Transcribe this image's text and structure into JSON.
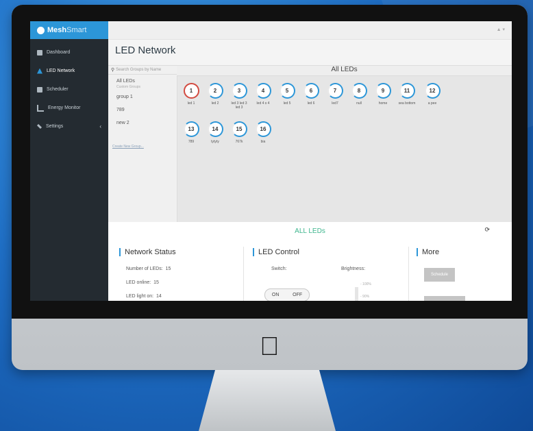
{
  "app": {
    "brand_bold": "Mesh",
    "brand_light": "Smart",
    "user_menu": "▲ ▾"
  },
  "sidebar": {
    "items": [
      {
        "label": "Dashboard",
        "icon": "dashboard-icon"
      },
      {
        "label": "LED Network",
        "icon": "network-icon"
      },
      {
        "label": "Scheduler",
        "icon": "calendar-icon"
      },
      {
        "label": "Energy Monitor",
        "icon": "bar-chart-icon"
      },
      {
        "label": "Settings",
        "icon": "wrench-icon",
        "chevron": "‹"
      }
    ]
  },
  "page": {
    "title": "LED Network"
  },
  "groups": {
    "search_placeholder": "Search Groups by Name",
    "all_leds": "All LEDs",
    "custom_heading": "Custom Groups",
    "items": [
      "group 1",
      "789",
      "new 2"
    ],
    "create_link": "Create New Group..."
  },
  "leds_header": "All LEDs",
  "leds": [
    {
      "num": "1",
      "label": "led 1"
    },
    {
      "num": "2",
      "label": "led 2"
    },
    {
      "num": "3",
      "label": "led 3 led 3 led 3"
    },
    {
      "num": "4",
      "label": "led 4 s 4"
    },
    {
      "num": "5",
      "label": "led 5"
    },
    {
      "num": "6",
      "label": "led 6"
    },
    {
      "num": "7",
      "label": "led7"
    },
    {
      "num": "8",
      "label": "null"
    },
    {
      "num": "9",
      "label": "home"
    },
    {
      "num": "11",
      "label": "sea bottom"
    },
    {
      "num": "12",
      "label": "a pee"
    },
    {
      "num": "13",
      "label": "789"
    },
    {
      "num": "14",
      "label": "tytyty"
    },
    {
      "num": "15",
      "label": "767k"
    },
    {
      "num": "16",
      "label": "bia"
    }
  ],
  "bottom": {
    "title": "ALL LEDs",
    "refresh_icon": "refresh-icon",
    "network_status": {
      "title": "Network Status",
      "num_leds_label": "Number of LEDs:",
      "num_leds": "15",
      "online_label": "LED online:",
      "online": "15",
      "light_on_label": "LED light on:",
      "light_on": "14"
    },
    "led_control": {
      "title": "LED Control",
      "switch_label": "Switch:",
      "brightness_label": "Brightness:",
      "on": "ON",
      "off": "OFF",
      "tick_100": "- 100%",
      "tick_90": "- 90%"
    },
    "more": {
      "title": "More",
      "schedule_button": "Schedule"
    }
  }
}
